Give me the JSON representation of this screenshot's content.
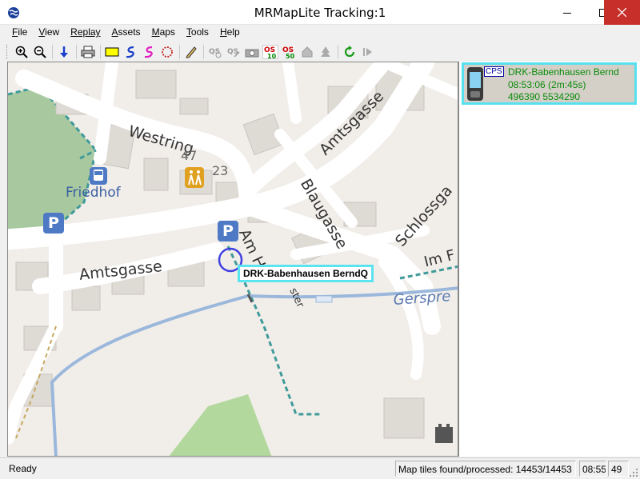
{
  "window": {
    "title": "MRMapLite Tracking:1",
    "icons": {
      "app": "globe-icon",
      "minimize": "minimize-icon",
      "maximize": "maximize-icon",
      "close": "close-icon"
    }
  },
  "menu": {
    "items": [
      {
        "key": "F",
        "rest": "ile"
      },
      {
        "key": "V",
        "rest": "iew"
      },
      {
        "key": "R",
        "rest": "eplay",
        "underline_all": false
      },
      {
        "key": "A",
        "rest": "ssets"
      },
      {
        "key": "M",
        "rest": "aps"
      },
      {
        "key": "T",
        "rest": "ools"
      },
      {
        "key": "H",
        "rest": "elp"
      }
    ]
  },
  "toolbar": {
    "buttons": [
      "zoom-in-icon",
      "zoom-out-icon",
      "arrow-down-icon",
      "print-icon",
      "rectangle-icon",
      "track-blue-icon",
      "track-pink-icon",
      "circle-dashed-icon",
      "pencil-icon",
      "qs-icon",
      "qs-alt-icon",
      "camera-icon",
      "os10-icon",
      "os50-icon",
      "house-icon",
      "tree-icon",
      "refresh-icon",
      "play-icon"
    ],
    "os10_label": "OS",
    "os10_sub": "10",
    "os50_label": "OS",
    "os50_sub": "50"
  },
  "map": {
    "labels": {
      "westring": "Westring",
      "amtsgasse_top": "Amtsgasse",
      "amtsgasse_bottom": "Amtsgasse",
      "blaugasse": "Blaugasse",
      "schlossgasse": "Schlossga",
      "friedhof": "Friedhof",
      "am_h": "Am H",
      "am_h_tail": "ster",
      "im_f": "Im F",
      "gersprenz": "Gerspre",
      "num_47": "47",
      "num_23": "23"
    },
    "parking_symbol": "P",
    "tracker_label": "DRK-Babenhausen BerndQ",
    "colors": {
      "background": "#f1eeea",
      "road": "#ffffff",
      "cemetery": "#a8c9a0",
      "water": "#aac8e8",
      "label_border": "#59e4f0"
    }
  },
  "assets_panel": {
    "items": [
      {
        "badge": "CPS",
        "name": "DRK-Babenhausen Bernd",
        "time": "08:53:06 (2m:45s)",
        "coords": "496390 5534290",
        "text_color": "#0a8a0a",
        "highlight_color": "#55e1ef"
      }
    ]
  },
  "status": {
    "ready": "Ready",
    "tiles": "Map tiles found/processed: 14453/14453",
    "time": "08:55",
    "extra": "49"
  }
}
